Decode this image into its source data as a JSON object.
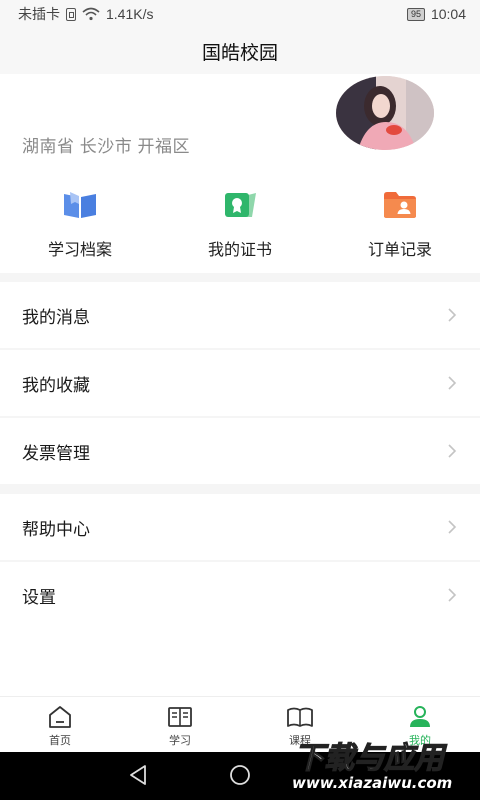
{
  "status_bar": {
    "carrier": "未插卡",
    "speed": "1.41K/s",
    "battery": "95",
    "time": "10:04"
  },
  "header": {
    "title": "国皓校园"
  },
  "profile": {
    "location": "湖南省 长沙市 开福区"
  },
  "quick_actions": [
    {
      "label": "学习档案",
      "icon": "book-icon",
      "color": "#4a7fe0"
    },
    {
      "label": "我的证书",
      "icon": "certificate-icon",
      "color": "#2fb66b"
    },
    {
      "label": "订单记录",
      "icon": "folder-user-icon",
      "color": "#f06b3a"
    }
  ],
  "menu": {
    "messages": "我的消息",
    "favorites": "我的收藏",
    "invoices": "发票管理",
    "help": "帮助中心",
    "settings": "设置"
  },
  "tabbar": {
    "items": [
      {
        "label": "首页",
        "icon": "home-icon"
      },
      {
        "label": "学习",
        "icon": "study-icon"
      },
      {
        "label": "课程",
        "icon": "course-icon"
      },
      {
        "label": "我的",
        "icon": "profile-icon",
        "active": true
      }
    ]
  },
  "watermark": {
    "text": "下载写应用",
    "url": "www.xiazaiwu.com"
  },
  "colors": {
    "accent": "#26b35a",
    "divider": "#f2f2f2"
  }
}
